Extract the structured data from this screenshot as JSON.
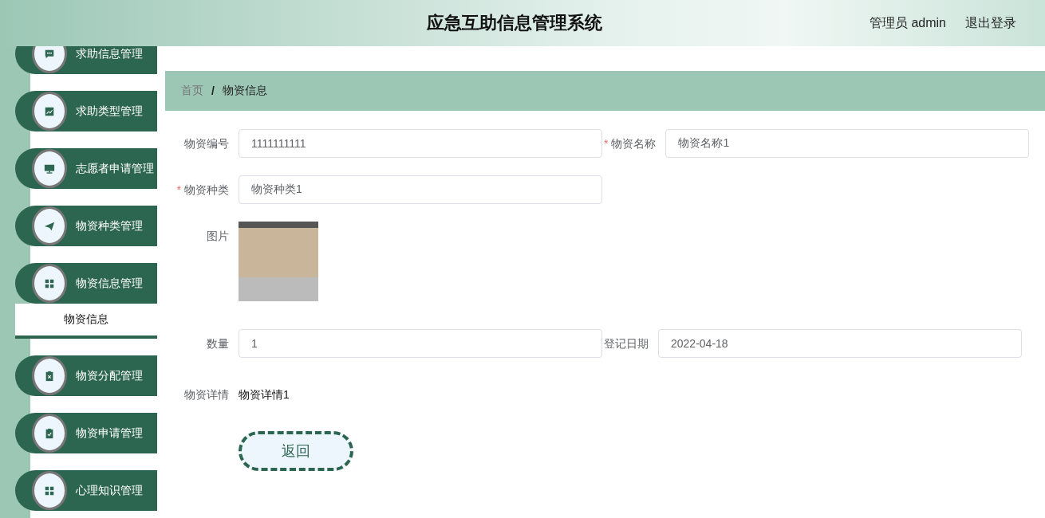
{
  "header": {
    "title": "应急互助信息管理系统",
    "user": "管理员 admin",
    "logout": "退出登录"
  },
  "menu": [
    {
      "label": "求助信息管理"
    },
    {
      "label": "求助类型管理"
    },
    {
      "label": "志愿者申请管理"
    },
    {
      "label": "物资种类管理"
    },
    {
      "label": "物资信息管理",
      "children": [
        {
          "label": "物资信息",
          "selected": true
        }
      ]
    },
    {
      "label": "物资分配管理"
    },
    {
      "label": "物资申请管理"
    },
    {
      "label": "心理知识管理"
    }
  ],
  "breadcrumb": [
    {
      "label": "首页"
    },
    {
      "label": "物资信息"
    }
  ],
  "breadcrumb_separator": "/",
  "form": {
    "required_mark": "*",
    "rows": [
      [
        {
          "kind": "input",
          "label": "物资编号",
          "required": false,
          "value": "1111111111"
        },
        {
          "kind": "input",
          "label": "物资名称",
          "required": true,
          "value": "物资名称1"
        }
      ],
      [
        {
          "kind": "input",
          "label": "物资种类",
          "required": true,
          "value": "物资种类1"
        }
      ],
      [
        {
          "kind": "image",
          "label": "图片",
          "required": false
        }
      ],
      [
        {
          "kind": "input",
          "label": "数量",
          "required": false,
          "value": "1"
        },
        {
          "kind": "input",
          "label": "登记日期",
          "required": false,
          "value": "2022-04-18"
        }
      ],
      [
        {
          "kind": "text",
          "label": "物资详情",
          "required": false,
          "value": "物资详情1"
        }
      ]
    ],
    "button": "返回"
  }
}
